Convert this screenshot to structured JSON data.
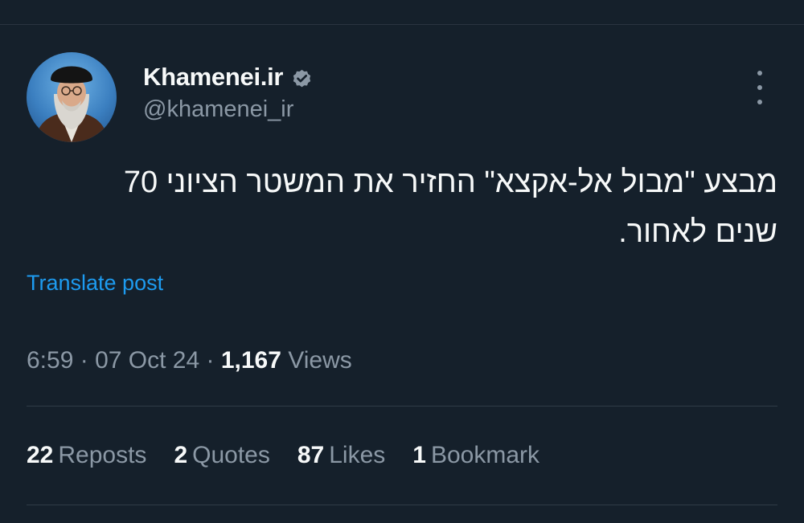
{
  "author": {
    "display_name": "Khamenei.ir",
    "handle": "@khamenei_ir",
    "verified": true,
    "avatar_icon": "portrait-avatar"
  },
  "post": {
    "text": "מבצע \"מבול אל-אקצא\" החזיר את המשטר הציוני 70 שנים לאחור.",
    "translate_label": "Translate post",
    "time": "6:59",
    "date": "07 Oct 24",
    "views_count": "1,167",
    "views_label": "Views",
    "separator": "·"
  },
  "stats": [
    {
      "count": "22",
      "label": "Reposts"
    },
    {
      "count": "2",
      "label": "Quotes"
    },
    {
      "count": "87",
      "label": "Likes"
    },
    {
      "count": "1",
      "label": "Bookmark"
    }
  ],
  "colors": {
    "background": "#15202b",
    "text_primary": "#f7f9f9",
    "text_secondary": "#8b98a5",
    "link": "#1d9bf0",
    "verified_badge": "#8b98a5"
  },
  "icons": {
    "verified": "verified-badge-icon",
    "more": "more-options-icon"
  }
}
